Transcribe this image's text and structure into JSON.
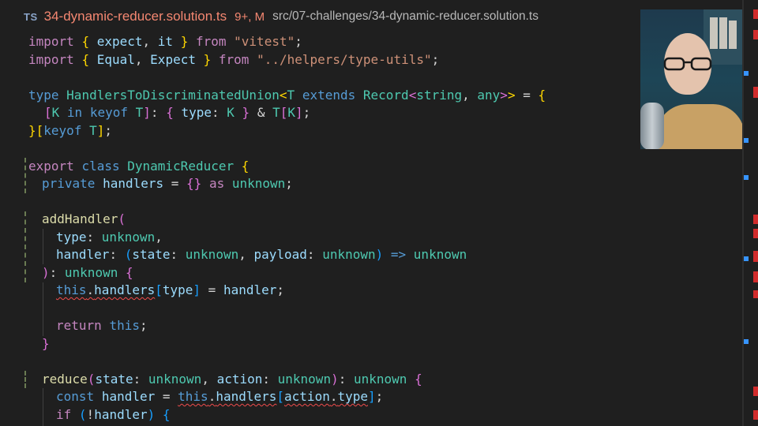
{
  "tab": {
    "lang_badge": "TS",
    "filename": "34-dynamic-reducer.solution.ts",
    "status": "9+, M",
    "path": "src/07-challenges/34-dynamic-reducer.solution.ts"
  },
  "code": {
    "l1": {
      "a": "import",
      "b": "{",
      "c": "expect",
      "d": ",",
      "e": "it",
      "f": "}",
      "g": "from",
      "h": "\"vitest\"",
      "i": ";"
    },
    "l2": {
      "a": "import",
      "b": "{",
      "c": "Equal",
      "d": ",",
      "e": "Expect",
      "f": "}",
      "g": "from",
      "h": "\"../helpers/type-utils\"",
      "i": ";"
    },
    "l4": {
      "a": "type",
      "b": "HandlersToDiscriminatedUnion",
      "c": "<",
      "d": "T",
      "e": "extends",
      "f": "Record",
      "g": "<",
      "h": "string",
      "i": ", ",
      "j": "any",
      "k": ">",
      "l": ">",
      "m": " = ",
      "n": "{"
    },
    "l5": {
      "a": "[",
      "b": "K",
      "c": "in",
      "d": "keyof",
      "e": "T",
      "f": "]",
      "g": ": ",
      "h": "{",
      "i": "type",
      "j": ": ",
      "k": "K",
      "l": "}",
      "m": " & ",
      "n": "T",
      "o": "[",
      "p": "K",
      "q": "]",
      "r": ";"
    },
    "l6": {
      "a": "}",
      "b": "[",
      "c": "keyof",
      "d": "T",
      "e": "]",
      "f": ";"
    },
    "l8": {
      "a": "export",
      "b": "class",
      "c": "DynamicReducer",
      "d": "{"
    },
    "l9": {
      "a": "private",
      "b": "handlers",
      "c": " = ",
      "d": "{}",
      "e": "as",
      "f": "unknown",
      "g": ";"
    },
    "l11": {
      "a": "addHandler",
      "b": "("
    },
    "l12": {
      "a": "type",
      "b": ": ",
      "c": "unknown",
      "d": ","
    },
    "l13": {
      "a": "handler",
      "b": ": ",
      "c": "(",
      "d": "state",
      "e": ": ",
      "f": "unknown",
      "g": ", ",
      "h": "payload",
      "i": ": ",
      "j": "unknown",
      "k": ")",
      "l": " => ",
      "m": "unknown"
    },
    "l14": {
      "a": ")",
      "b": ": ",
      "c": "unknown",
      "d": "{"
    },
    "l15": {
      "a": "this",
      "b": ".",
      "c": "handlers",
      "d": "[",
      "e": "type",
      "f": "]",
      "g": " = ",
      "h": "handler",
      "i": ";"
    },
    "l17": {
      "a": "return",
      "b": "this",
      "c": ";"
    },
    "l18": {
      "a": "}"
    },
    "l20": {
      "a": "reduce",
      "b": "(",
      "c": "state",
      "d": ": ",
      "e": "unknown",
      "f": ", ",
      "g": "action",
      "h": ": ",
      "i": "unknown",
      "j": ")",
      "k": ": ",
      "l": "unknown",
      "m": "{"
    },
    "l21": {
      "a": "const",
      "b": "handler",
      "c": " = ",
      "d": "this",
      "e": ".",
      "f": "handlers",
      "g": "[",
      "h": "action",
      "i": ".",
      "j": "type",
      "k": "]",
      "l": ";"
    },
    "l22": {
      "a": "if",
      "b": "(",
      "c": "!",
      "d": "handler",
      "e": ")",
      "f": "{"
    }
  },
  "colors": {
    "background": "#1f1f1f",
    "error": "#f14c4c",
    "modified": "#f48771"
  }
}
